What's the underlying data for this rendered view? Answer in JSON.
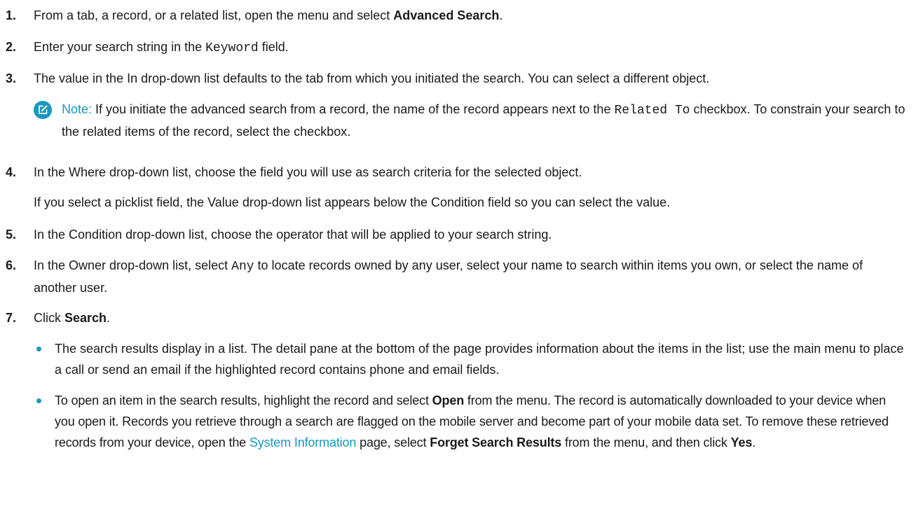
{
  "steps": [
    {
      "number": "1.",
      "pre": "From a tab, a record, or a related list, open the menu and select ",
      "bold": "Advanced Search",
      "post": "."
    },
    {
      "number": "2.",
      "pre": "Enter your search string in the ",
      "code": "Keyword",
      "post": " field."
    },
    {
      "number": "3.",
      "text": "The value in the In drop-down list defaults to the tab from which you initiated the search. You can select a different object."
    },
    {
      "number": "4.",
      "text": "In the Where drop-down list, choose the field you will use as search criteria for the selected object.",
      "followup": "If you select a picklist field, the Value drop-down list appears below the Condition field so you can select the value."
    },
    {
      "number": "5.",
      "text": "In the Condition drop-down list, choose the operator that will be applied to your search string."
    },
    {
      "number": "6.",
      "pre": "In the Owner drop-down list, select ",
      "code": "Any",
      "post": " to locate records owned by any user, select your name to search within items you own, or select the name of another user."
    },
    {
      "number": "7.",
      "pre": "Click ",
      "bold": "Search",
      "post": "."
    }
  ],
  "note": {
    "label": "Note:",
    "pre": " If you initiate the advanced search from a record, the name of the record appears next to the ",
    "code": "Related To",
    "post": " checkbox. To constrain your search to the related items of the record, select the checkbox.",
    "icon": "edit-note-icon",
    "icon_color": "#1798c1"
  },
  "bullets": {
    "b1": "The search results display in a list. The detail pane at the bottom of the page provides information about the items in the list; use the main menu to place a call or send an email if the highlighted record contains phone and email fields.",
    "b2_pre": "To open an item in the search results, highlight the record and select ",
    "b2_bold1": "Open",
    "b2_mid1": " from the menu. The record is automatically downloaded to your device when you open it. Records you retrieve through a search are flagged on the mobile server and become part of your mobile data set. To remove these retrieved records from your device, open the ",
    "b2_link": "System Information",
    "b2_mid2": " page, select ",
    "b2_bold2": "Forget Search Results",
    "b2_mid3": " from the menu, and then click ",
    "b2_bold3": "Yes",
    "b2_post": "."
  },
  "colors": {
    "accent": "#1798c1",
    "text": "#1a1a1a"
  }
}
